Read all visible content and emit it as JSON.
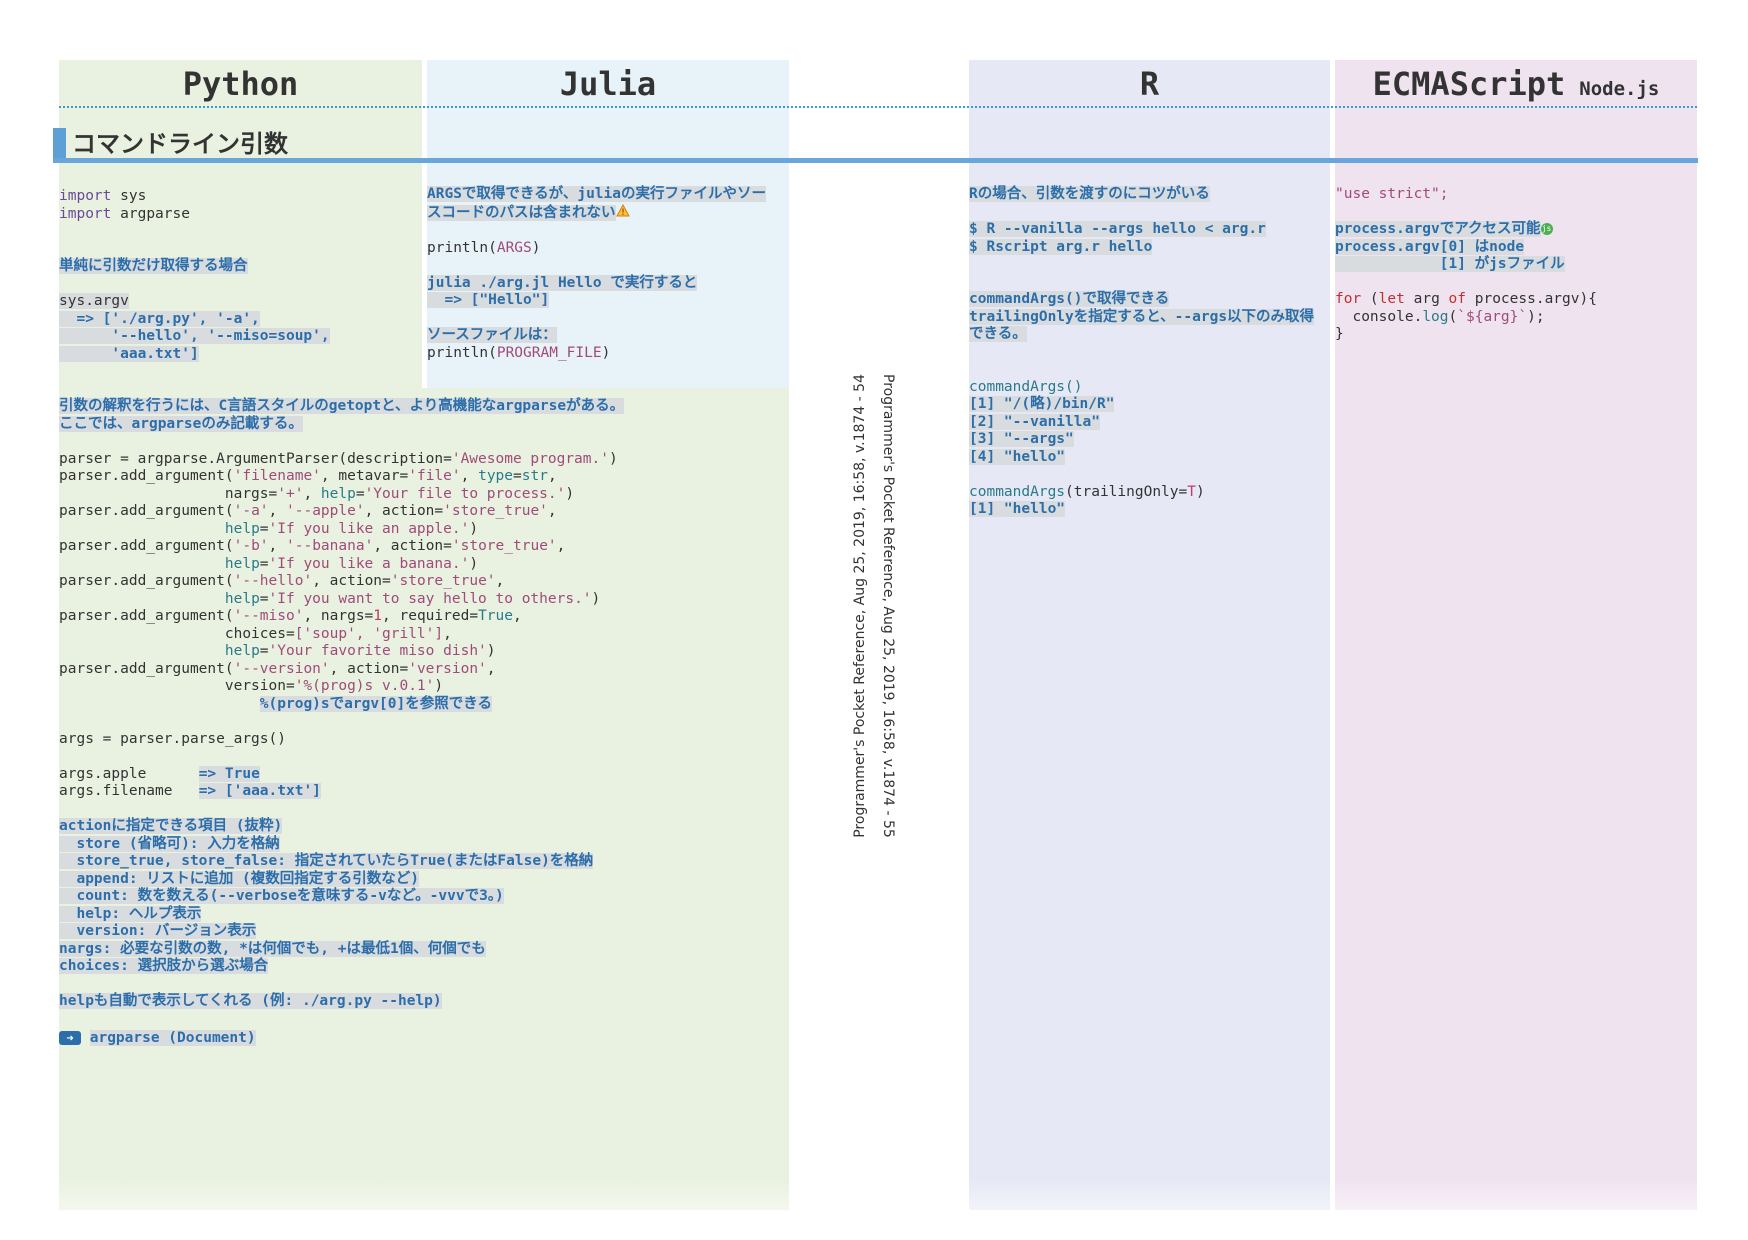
{
  "headers": {
    "python": "Python",
    "julia": "Julia",
    "r": "R",
    "js": "ECMAScript",
    "js_sub": "Node.js"
  },
  "section": {
    "title": "コマンドライン引数"
  },
  "vertical": {
    "left": "Programmer's Pocket Reference, Aug 25, 2019, 16:58, v.1874 - 54",
    "right": "Programmer's Pocket Reference, Aug 25, 2019, 16:58, v.1874 - 55"
  },
  "python": {
    "import_sys": "sys",
    "import_argparse": "argparse",
    "note_simple": "単純に引数だけ取得する場合",
    "sys_argv": "sys.argv",
    "argv_r1": "  => ['./arg.py', '-a',",
    "argv_r2": "      '--hello', '--miso=soup',",
    "argv_r3": "      'aaa.txt']",
    "note_parse1": "引数の解釈を行うには、C言語スタイルのgetoptと、より高機能なargparseがある。",
    "note_parse2": "ここでは、argparseのみ記載する。",
    "p1": "parser = argparse.ArgumentParser(description=",
    "p1s": "'Awesome program.'",
    "p1e": ")",
    "aa": "parser.add_argument(",
    "a1": "'filename'",
    "a1b": ", metavar=",
    "a1c": "'file'",
    "a1d": ", ",
    "a1e": "type",
    "a1f": "=",
    "a1g": "str",
    "a1h": ",",
    "a2": "                   nargs=",
    "a2b": "'+'",
    "a2c": ", ",
    "a2d": "help",
    "a2e": "=",
    "a2f": "'Your file to process.'",
    "a2g": ")",
    "b1": "'-a'",
    "b1b": ", ",
    "b1c": "'--apple'",
    "b1d": ", action=",
    "b1e": "'store_true'",
    "b2": "'If you like an apple.'",
    "c1": "'-b'",
    "c1c": "'--banana'",
    "c2": "'If you like a banana.'",
    "d1": "'--hello'",
    "d2": "'If you want to say hello to others.'",
    "e1": "'--miso'",
    "e1b": ", nargs=",
    "e1c": "1",
    "e1d": ", required=",
    "e1e": "True",
    "e2": "                   choices=",
    "e2b": "['soup', 'grill']",
    "e3": "'Your favorite miso dish'",
    "f1": "'--version'",
    "f1e": "'version'",
    "f2": "                   version=",
    "f2b": "'%(prog)s v.0.1'",
    "f3": "%(prog)sでargv[0]を参照できる",
    "g1": "args = parser.parse_args()",
    "h1": "args.apple      ",
    "h1b": "=> True",
    "h2": "args.filename   ",
    "h2b": "=> ['aaa.txt']",
    "act_title": "actionに指定できる項目 (抜粋)",
    "act1": "  store (省略可): 入力を格納",
    "act2": "  store_true, store_false: 指定されていたらTrue(またはFalse)を格納",
    "act3": "  append: リストに追加 (複数回指定する引数など)",
    "act4": "  count: 数を数える(--verboseを意味する-vなど。-vvvで3。)",
    "act5": "  help: ヘルプ表示",
    "act6": "  version: バージョン表示",
    "nargs": "nargs: 必要な引数の数, *は何個でも, +は最低1個、何個でも",
    "choices": "choices: 選択肢から選ぶ場合",
    "help_auto": "helpも自動で表示してくれる (例: ./arg.py --help)",
    "link": "argparse (Document)"
  },
  "julia": {
    "note1": "ARGSで取得できるが、juliaの実行ファイルやソー",
    "note2": "スコードのパスは含まれない",
    "println": "println(",
    "args": "ARGS",
    "close": ")",
    "run1": "julia ./arg.jl Hello で実行すると",
    "run2": "  => [\"Hello\"]",
    "src": "ソースファイルは：",
    "prog": "PROGRAM_FILE"
  },
  "r": {
    "note1": "Rの場合、引数を渡すのにコツがいる",
    "cmd1": "$ R --vanilla --args hello < arg.r",
    "cmd2": "$ Rscript arg.r hello",
    "note2": "commandArgs()で取得できる",
    "note3": "trailingOnlyを指定すると、--args以下のみ取得",
    "note4": "できる。",
    "ca": "commandArgs",
    "ca_p": "()",
    "o1": "[1] \"/(略)/bin/R\"",
    "o2": "[2] \"--vanilla\"",
    "o3": "[3] \"--args\"",
    "o4": "[4] \"hello\"",
    "ca2": "(trailingOnly=",
    "ca2b": "T",
    "ca2c": ")",
    "o5": "[1] \"hello\""
  },
  "js": {
    "strict": "\"use strict\";",
    "n1": "process.argvでアクセス可能",
    "n2": "process.argv[0] はnode",
    "n3": "            [1] がjsファイル",
    "for": "for",
    "for2": " (",
    "let": "let",
    "for3": " arg ",
    "of": "of",
    "for4": " process.argv){",
    "cl": "  console.",
    "log": "log",
    "cl2": "(",
    "tpl": "`${arg}`",
    "cl3": ");",
    "close": "}"
  }
}
